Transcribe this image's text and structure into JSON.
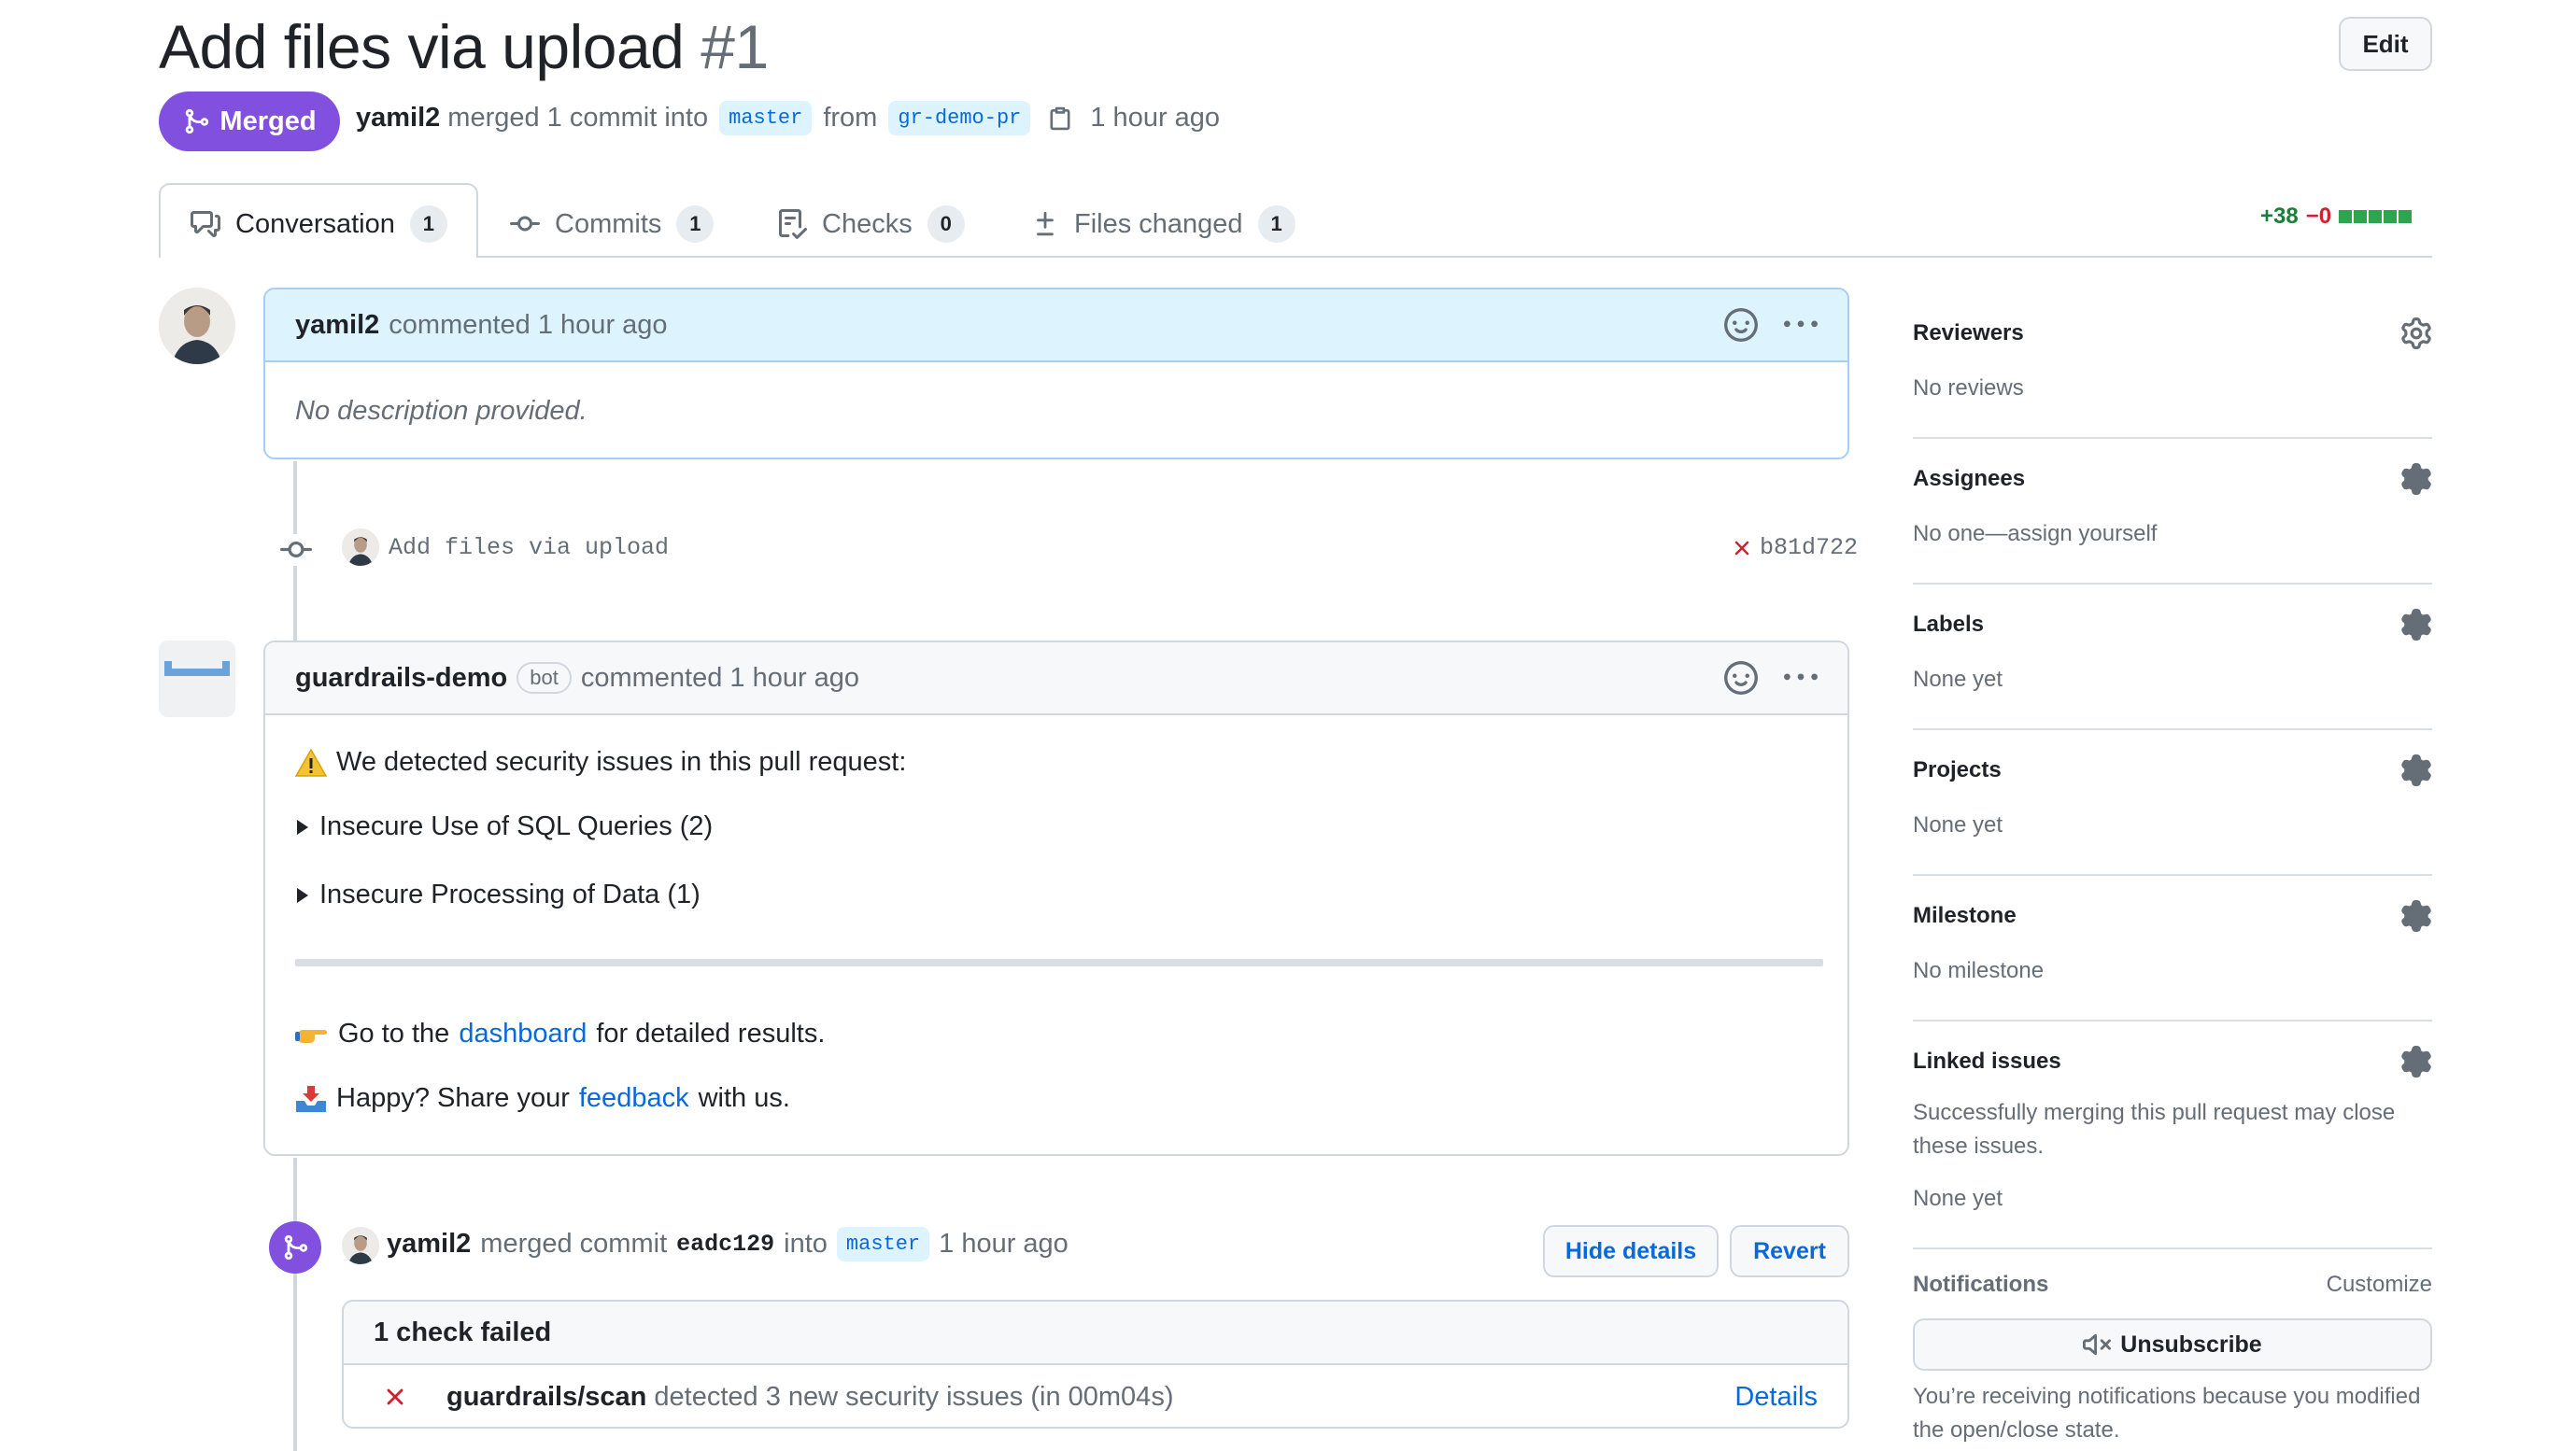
{
  "header": {
    "title": "Add files via upload",
    "number": "#1",
    "edit_label": "Edit",
    "status_label": "Merged",
    "merger": "yamil2",
    "merge_text": "merged 1 commit into",
    "base_branch": "master",
    "from_text": "from",
    "head_branch": "gr-demo-pr",
    "time": "1 hour ago"
  },
  "tabs": [
    {
      "label": "Conversation",
      "count": "1",
      "icon": "conversation-icon"
    },
    {
      "label": "Commits",
      "count": "1",
      "icon": "commit-icon"
    },
    {
      "label": "Checks",
      "count": "0",
      "icon": "checklist-icon"
    },
    {
      "label": "Files changed",
      "count": "1",
      "icon": "file-diff-icon"
    }
  ],
  "diffstat": {
    "additions": "+38",
    "deletions": "−0",
    "added_blocks": 5
  },
  "first_comment": {
    "author": "yamil2",
    "action": "commented 1 hour ago",
    "body": "No description provided."
  },
  "commit": {
    "message": "Add files via upload",
    "sha": "b81d722",
    "status": "failed"
  },
  "bot_comment": {
    "author": "guardrails-demo",
    "badge": "bot",
    "action": "commented 1 hour ago",
    "intro": "We detected security issues in this pull request:",
    "details": [
      "Insecure Use of SQL Queries (2)",
      "Insecure Processing of Data (1)"
    ],
    "dashboard_pre": "Go to the",
    "dashboard_link": "dashboard",
    "dashboard_post": "for detailed results.",
    "feedback_pre": "Happy? Share your",
    "feedback_link": "feedback",
    "feedback_post": "with us."
  },
  "merge_event": {
    "author": "yamil2",
    "action": "merged commit",
    "sha": "eadc129",
    "into": "into",
    "branch": "master",
    "time": "1 hour ago",
    "hide_details": "Hide details",
    "revert": "Revert",
    "checks_summary": "1 check failed",
    "check_name": "guardrails/scan",
    "check_desc": "detected 3 new security issues (in 00m04s)",
    "check_details": "Details"
  },
  "sidebar": {
    "reviewers": {
      "title": "Reviewers",
      "value": "No reviews"
    },
    "assignees": {
      "title": "Assignees",
      "value": "No one—assign yourself"
    },
    "labels": {
      "title": "Labels",
      "value": "None yet"
    },
    "projects": {
      "title": "Projects",
      "value": "None yet"
    },
    "milestone": {
      "title": "Milestone",
      "value": "No milestone"
    },
    "linked_issues": {
      "title": "Linked issues",
      "description": "Successfully merging this pull request may close these issues.",
      "value": "None yet"
    },
    "notifications": {
      "title": "Notifications",
      "customize": "Customize",
      "unsubscribe": "Unsubscribe",
      "reason": "You’re receiving notifications because you modified the open/close state."
    }
  },
  "colors": {
    "merged": "#8250df",
    "link": "#0969da",
    "added": "#1a7f37",
    "deleted": "#cf222e"
  }
}
